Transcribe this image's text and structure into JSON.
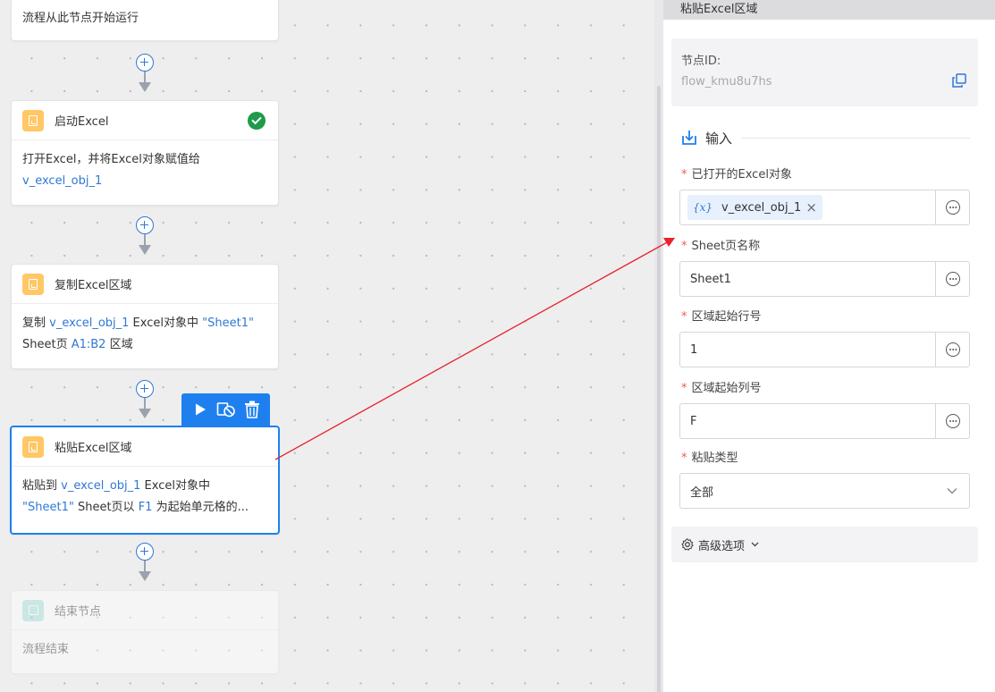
{
  "canvas": {
    "start_node": {
      "body": "流程从此节点开始运行"
    },
    "nodes": [
      {
        "title": "启动Excel",
        "status": "success",
        "body": [
          {
            "t": "打开Excel，并将Excel对象赋值给",
            "v": false
          },
          {
            "t": "v_excel_obj_1",
            "v": true
          }
        ]
      },
      {
        "title": "复制Excel区域",
        "body": [
          {
            "t": "复制 ",
            "v": false
          },
          {
            "t": "v_excel_obj_1",
            "v": true
          },
          {
            "t": " Excel对象中 ",
            "v": false
          },
          {
            "t": "\"Sheet1\"",
            "v": true
          },
          {
            "t": "Sheet页 ",
            "v": false
          },
          {
            "t": "A1:B2",
            "v": true
          },
          {
            "t": " 区域",
            "v": false
          }
        ]
      },
      {
        "title": "粘贴Excel区域",
        "selected": true,
        "body": [
          {
            "t": "粘贴到 ",
            "v": false
          },
          {
            "t": "v_excel_obj_1",
            "v": true
          },
          {
            "t": " Excel对象中",
            "v": false
          },
          {
            "t": "\"Sheet1\"",
            "v": true
          },
          {
            "t": " Sheet页以 ",
            "v": false
          },
          {
            "t": "F1",
            "v": true
          },
          {
            "t": " 为起始单元格的...",
            "v": false
          }
        ]
      }
    ],
    "end_node": {
      "title": "结束节点",
      "body": "流程结束"
    },
    "toolbar": {
      "run_icon": "play-icon",
      "disable_icon": "disable-icon",
      "delete_icon": "trash-icon"
    }
  },
  "panel": {
    "header": "粘贴Excel区域",
    "node_id_label": "节点ID:",
    "node_id_value": "flow_kmu8u7hs",
    "input_section": "输入",
    "fields": {
      "excel_object": {
        "label": "已打开的Excel对象",
        "tag_icon": "{x}",
        "value": "v_excel_obj_1"
      },
      "sheet_name": {
        "label": "Sheet页名称",
        "value": "Sheet1"
      },
      "start_row": {
        "label": "区域起始行号",
        "value": "1"
      },
      "start_col": {
        "label": "区域起始列号",
        "value": "F"
      },
      "paste_type": {
        "label": "粘贴类型",
        "value": "全部"
      }
    },
    "advanced": "高级选项"
  },
  "colors": {
    "accent": "#1e80ef",
    "variable": "#2f78d4",
    "required": "#f05b4d",
    "success": "#1e9b4b",
    "annotation_arrow": "#e8232a"
  }
}
